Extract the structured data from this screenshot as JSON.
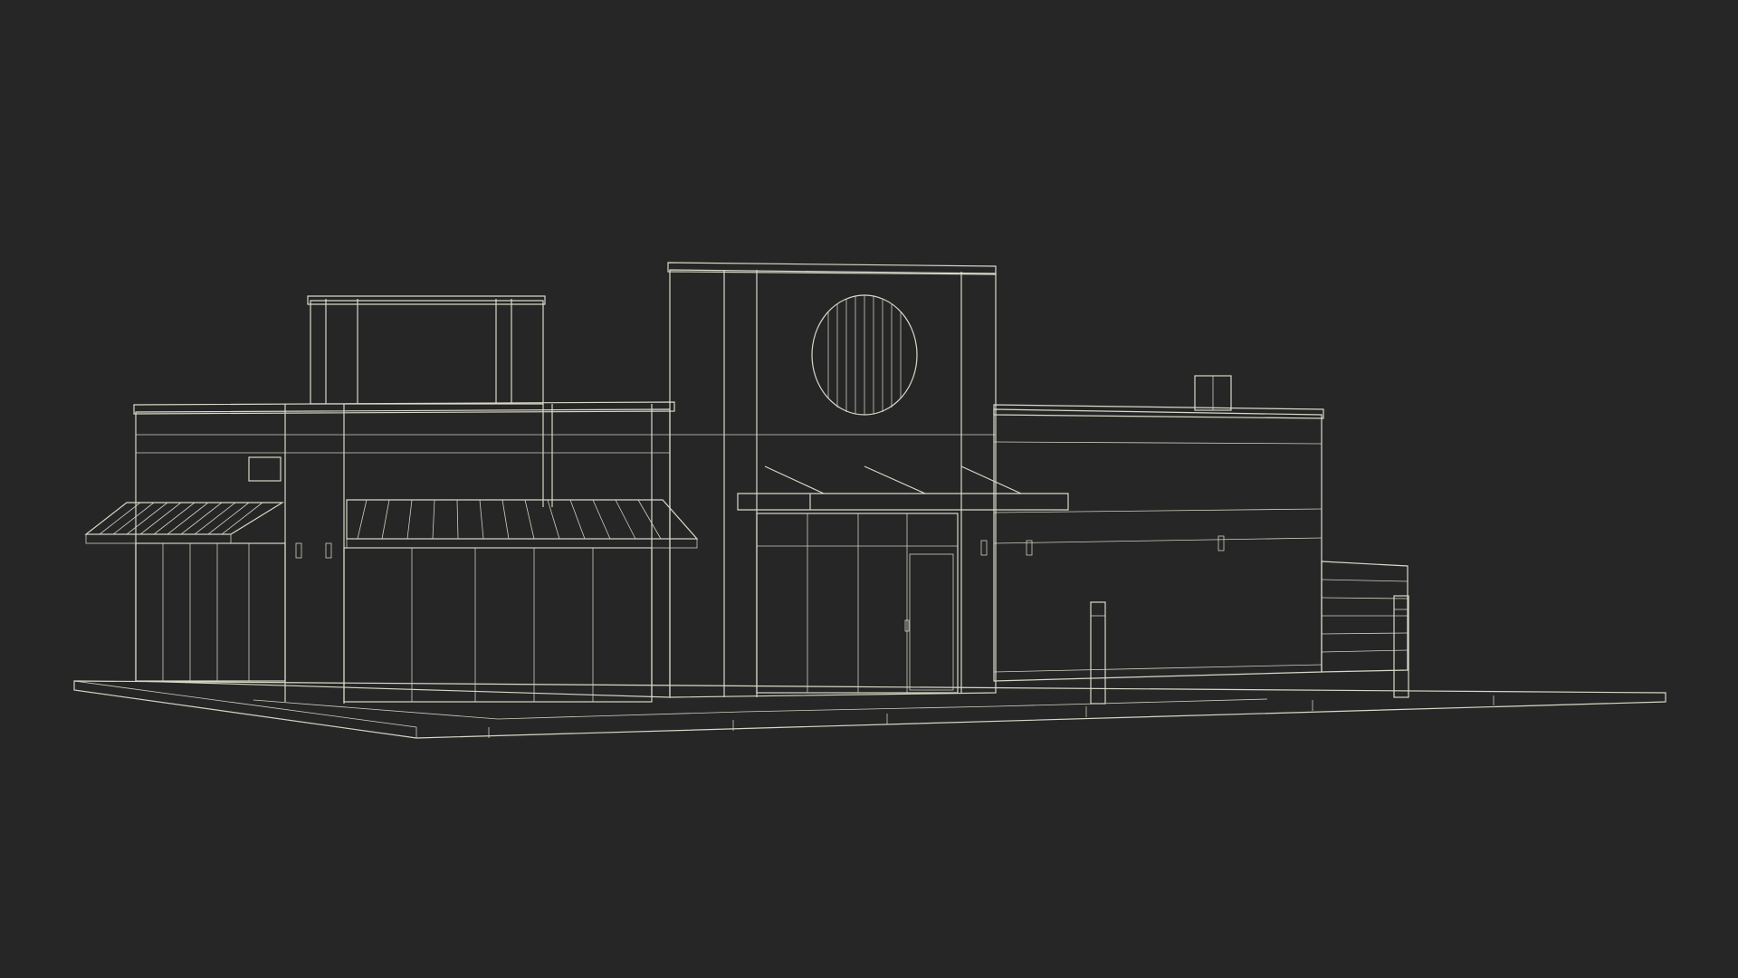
{
  "scene": {
    "subject": "",
    "render_style": "wireframe-over-shaded",
    "background_color": "#262626",
    "surface_color": "#6d6e60",
    "surface_shadow_color": "#5a5b4f",
    "wire_color": "#d8d8c8"
  }
}
